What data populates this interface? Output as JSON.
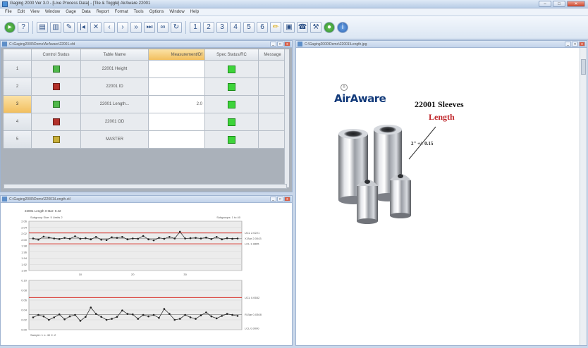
{
  "app": {
    "title": "Gaging 2000 Ver 3.0 - [Live Process Data] - [Tile & Toggle] AirAware 22001",
    "window_buttons": [
      "–",
      "□",
      "✕"
    ]
  },
  "menu": [
    "File",
    "Edit",
    "View",
    "Window",
    "Gage",
    "Data",
    "Report",
    "Format",
    "Tools",
    "Options",
    "Window",
    "Help"
  ],
  "toolbar": {
    "buttons": [
      "run-icon",
      "help-icon",
      "print-icon",
      "setup-icon",
      "tools-icon",
      "first-icon",
      "cut-icon",
      "prev-icon",
      "next-icon",
      "last-icon",
      "skip-icon",
      "binocular-icon",
      "refresh-icon",
      "gage1-icon",
      "gage2-icon",
      "gage3-icon",
      "gage4-icon",
      "gage5-icon",
      "gage6-icon",
      "pencil-icon",
      "cube-icon",
      "phone-icon",
      "wrench-icon",
      "go-icon",
      "info-icon"
    ]
  },
  "grid_window": {
    "title": "C:\\Gaging2000\\Demo\\AirAware\\22001.cfd",
    "columns": [
      "Control Status",
      "Table Name",
      "Measurement/Df",
      "Spec Status/RC",
      "Message"
    ],
    "rows": [
      {
        "num": "1",
        "control": "green",
        "name": "22001 Height",
        "meas": "",
        "spec": "green"
      },
      {
        "num": "2",
        "control": "red",
        "name": "22001 ID",
        "meas": "",
        "spec": "green"
      },
      {
        "num": "3",
        "control": "green",
        "name": "22001 Length...",
        "meas": "2.0",
        "spec": "green"
      },
      {
        "num": "4",
        "control": "red",
        "name": "22001 OD",
        "meas": "",
        "spec": "green"
      },
      {
        "num": "5",
        "control": "yellow",
        "name": "MASTER",
        "meas": "",
        "spec": "green"
      }
    ],
    "selected_row": 3
  },
  "chart_window": {
    "title": "C:\\Gaging2000\\Demo\\22001\\Length.ctl"
  },
  "chart_data": [
    {
      "type": "line",
      "title": "22001 Length  X-Bar: 0.42",
      "note_left": "Subgroup Size: 5  Limits 2",
      "note_right": "Subgroups: 1 to 40",
      "ylim": [
        1.9,
        2.06
      ],
      "yticks": [
        "2.06",
        "2.04",
        "2.02",
        "2.00",
        "1.98",
        "1.96",
        "1.94",
        "1.92",
        "1.90"
      ],
      "xticks": [
        "10",
        "20",
        "30"
      ],
      "limit_labels": [
        "UCL 2.0221",
        "X-Bar 2.0043",
        "LCL 1.9865"
      ],
      "ucl": 2.0221,
      "center": 2.0043,
      "lcl": 1.9865,
      "values": [
        2.004,
        2.0,
        2.01,
        2.007,
        2.004,
        2.002,
        2.006,
        2.003,
        2.011,
        2.003,
        2.005,
        2.001,
        2.009,
        2.0,
        1.999,
        2.008,
        2.006,
        2.009,
        2.001,
        2.004,
        2.003,
        2.012,
        2.001,
        1.998,
        2.006,
        2.003,
        2.009,
        2.004,
        2.026,
        2.004,
        2.005,
        2.006,
        2.004,
        2.007,
        2.002,
        2.009,
        2.001,
        2.005,
        2.003,
        2.004
      ]
    },
    {
      "type": "line",
      "title": "",
      "note_bottom": "Sample: 1  n: 40  X: 2",
      "ylim": [
        0.0,
        0.1
      ],
      "yticks": [
        "0.10",
        "0.08",
        "0.06",
        "0.04",
        "0.02",
        "0.00"
      ],
      "limit_labels": [
        "UCL 0.0652",
        "R-Bar 0.0308",
        "LCL 0.0000"
      ],
      "ucl": 0.0652,
      "center": 0.0308,
      "lcl": 0.0,
      "values": [
        0.025,
        0.03,
        0.027,
        0.02,
        0.025,
        0.031,
        0.021,
        0.027,
        0.03,
        0.018,
        0.026,
        0.045,
        0.032,
        0.026,
        0.02,
        0.022,
        0.026,
        0.039,
        0.032,
        0.031,
        0.022,
        0.03,
        0.027,
        0.03,
        0.024,
        0.042,
        0.032,
        0.02,
        0.022,
        0.03,
        0.025,
        0.022,
        0.029,
        0.035,
        0.027,
        0.023,
        0.028,
        0.032,
        0.03,
        0.028
      ]
    }
  ],
  "image_window": {
    "title": "C:\\Gaging2000\\Demo\\22001\\Length.jpg",
    "logo": "AirAware",
    "logo_mark": "®",
    "product_title": "22001 Sleeves",
    "feature": "Length",
    "dimension": "2\" +/- 0.15"
  }
}
